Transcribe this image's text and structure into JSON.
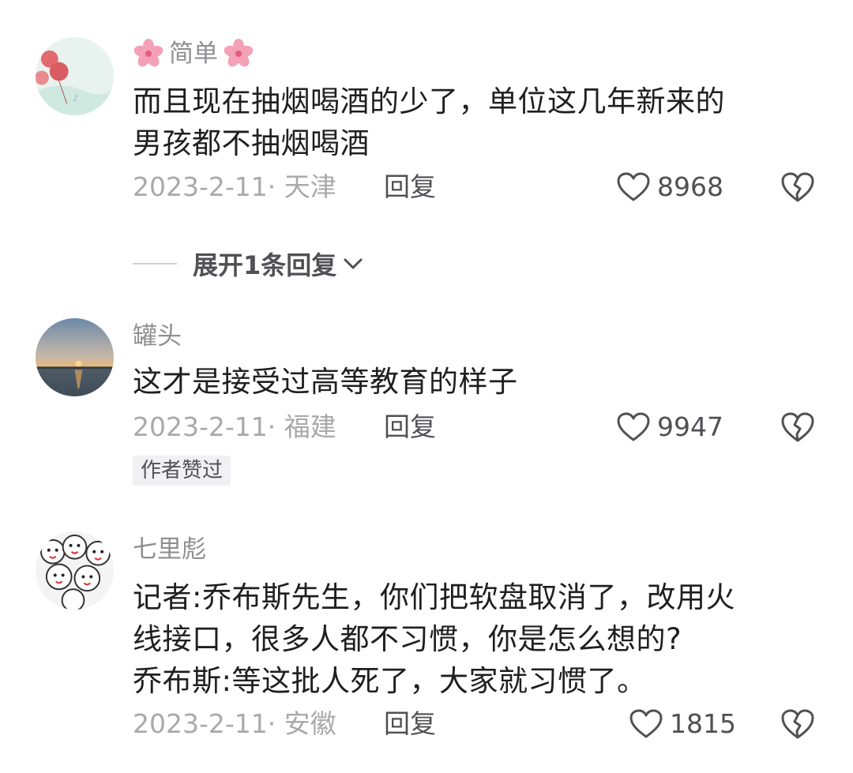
{
  "comments": [
    {
      "username": "简单",
      "text": "而且现在抽烟喝酒的少了，单位这几年新来的\n男孩都不抽烟喝酒",
      "date_location": "2023-2-11· 天津",
      "reply_label": "回复",
      "likes": "8968"
    },
    {
      "username": "罐头",
      "text": "这才是接受过高等教育的样子",
      "date_location": "2023-2-11· 福建",
      "reply_label": "回复",
      "likes": "9947",
      "badge": "作者赞过"
    },
    {
      "username": "七里彪",
      "text": "记者:乔布斯先生，你们把软盘取消了，改用火\n线接口，很多人都不习惯，你是怎么想的?\n乔布斯:等这批人死了，大家就习惯了。",
      "date_location": "2023-2-11· 安徽",
      "reply_label": "回复",
      "likes": "1815"
    }
  ],
  "expand_replies": {
    "label": "展开1条回复"
  },
  "icons": {
    "like": "heart-outline-icon",
    "dislike": "broken-heart-icon",
    "expand": "chevron-down-icon",
    "username_decoration": "cherry-blossom-icon"
  },
  "colors": {
    "username": "#8f8f93",
    "text": "#1f1f1f",
    "meta": "#a9a9ad",
    "action": "#505055",
    "badge_bg": "#f1f1f3",
    "flower": "#f4a0b6"
  }
}
